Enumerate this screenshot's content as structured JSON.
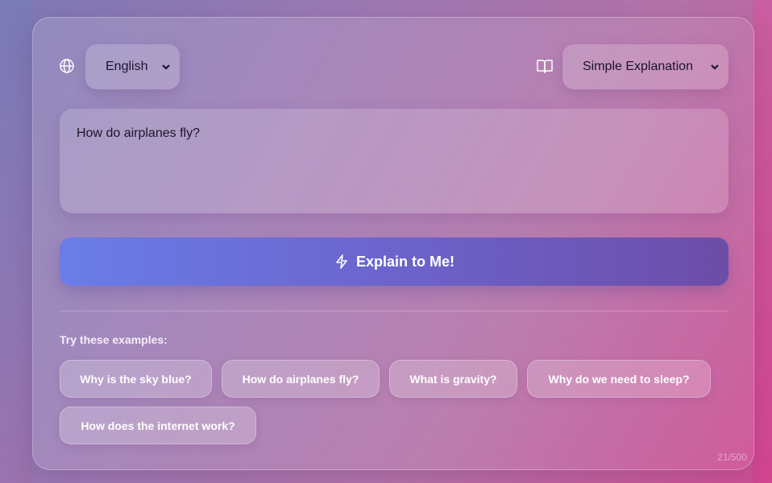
{
  "language": {
    "selected": "English",
    "icon": "globe-icon"
  },
  "mode": {
    "selected": "Simple Explanation",
    "icon": "book-open-icon"
  },
  "question": {
    "value": "How do airplanes fly?"
  },
  "action": {
    "label": "Explain to Me!",
    "icon": "lightning-icon"
  },
  "examples": {
    "heading": "Try these examples:",
    "items": [
      "Why is the sky blue?",
      "How do airplanes fly?",
      "What is gravity?",
      "Why do we need to sleep?",
      "How does the internet work?"
    ]
  },
  "char_counter": "21/500",
  "colors": {
    "button_gradient_start": "#6a7de8",
    "button_gradient_end": "#6c4da8",
    "background_accent": "#cf4f93"
  }
}
